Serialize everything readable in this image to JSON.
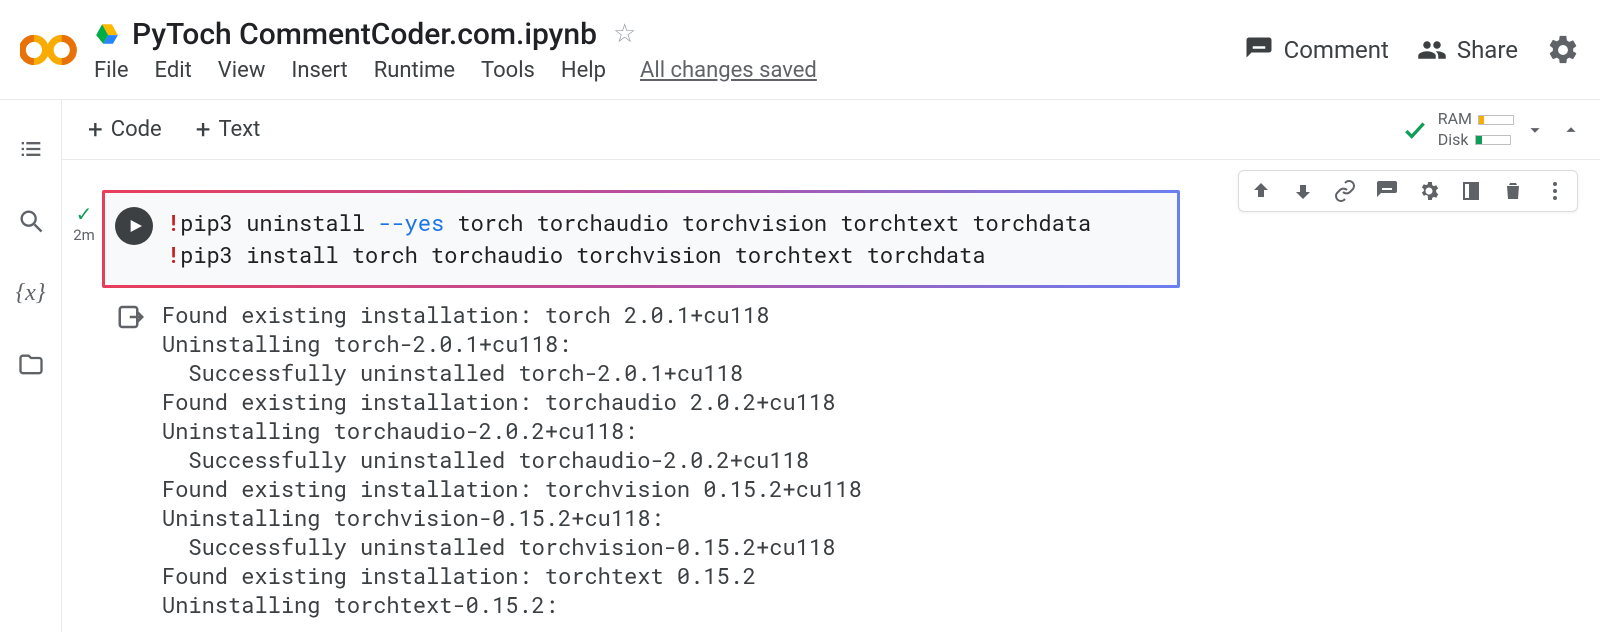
{
  "header": {
    "notebook_title": "PyToch CommentCoder.com.ipynb",
    "menus": [
      "File",
      "Edit",
      "View",
      "Insert",
      "Runtime",
      "Tools",
      "Help"
    ],
    "save_status": "All changes saved",
    "comment_label": "Comment",
    "share_label": "Share"
  },
  "toolbar": {
    "add_code": "Code",
    "add_text": "Text",
    "ram_label": "RAM",
    "disk_label": "Disk"
  },
  "cell": {
    "duration": "2m",
    "code_lines": [
      {
        "bang": "!",
        "cmd": "pip3 uninstall ",
        "flag": "--yes",
        "rest": " torch torchaudio torchvision torchtext torchdata"
      },
      {
        "bang": "!",
        "cmd": "pip3 install torch torchaudio torchvision torchtext torchdata",
        "flag": "",
        "rest": ""
      }
    ],
    "output_lines": [
      "Found existing installation: torch 2.0.1+cu118",
      "Uninstalling torch-2.0.1+cu118:",
      "  Successfully uninstalled torch-2.0.1+cu118",
      "Found existing installation: torchaudio 2.0.2+cu118",
      "Uninstalling torchaudio-2.0.2+cu118:",
      "  Successfully uninstalled torchaudio-2.0.2+cu118",
      "Found existing installation: torchvision 0.15.2+cu118",
      "Uninstalling torchvision-0.15.2+cu118:",
      "  Successfully uninstalled torchvision-0.15.2+cu118",
      "Found existing installation: torchtext 0.15.2",
      "Uninstalling torchtext-0.15.2:"
    ]
  }
}
